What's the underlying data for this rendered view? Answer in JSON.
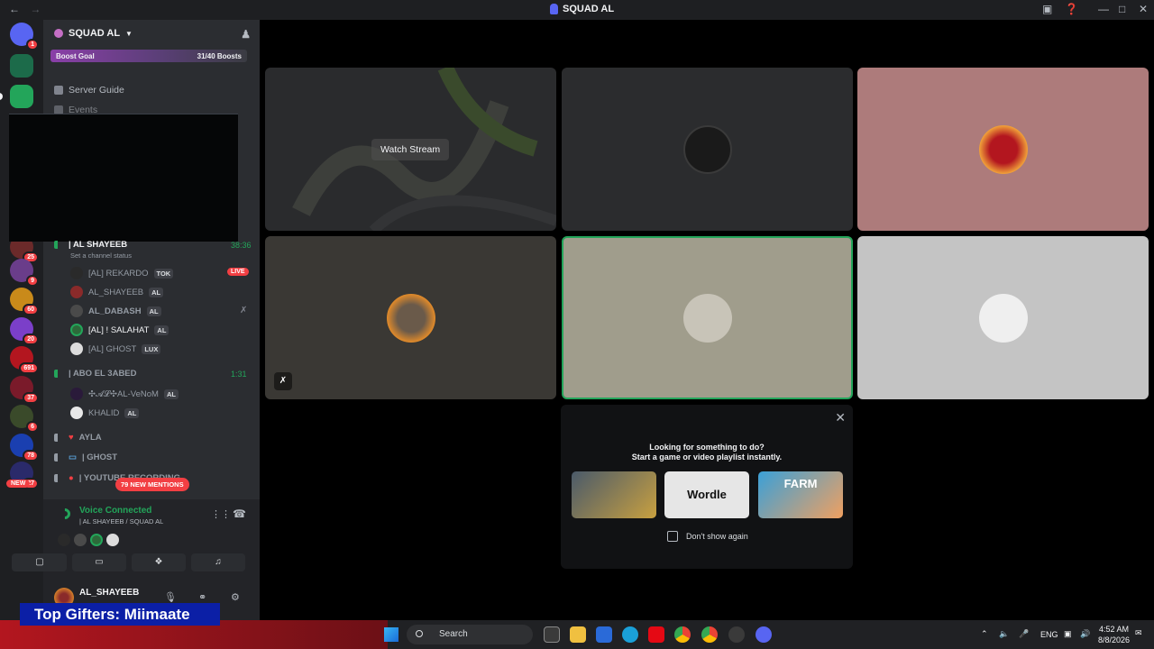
{
  "window": {
    "title": "SQUAD AL"
  },
  "guild_badges": [
    "1",
    "25",
    "9",
    "60",
    "20",
    "691",
    "37",
    "6",
    "78",
    "27"
  ],
  "new_badge": "NEW",
  "server": {
    "name": "SQUAD AL",
    "boost_label": "Boost Goal",
    "boost_progress": "31/40 Boosts",
    "boost_fraction": 0.775,
    "nav": [
      {
        "label": "Server Guide",
        "icon": "server-guide-icon"
      },
      {
        "label": "Events",
        "icon": "calendar-icon"
      }
    ]
  },
  "voice_channels": [
    {
      "name": "| AL SHAYEEB",
      "time": "38:36",
      "status": "Set a channel status",
      "members": [
        {
          "name": "[AL] REKARDO",
          "tag": "TOK",
          "live": "LIVE"
        },
        {
          "name": "AL_SHAYEEB",
          "tag": "AL"
        },
        {
          "name": "AL_DABASH",
          "tag": "AL"
        },
        {
          "name": "[AL] ! SALAHAT",
          "tag": "AL"
        },
        {
          "name": "[AL] GHOST",
          "tag": "LUX"
        }
      ]
    },
    {
      "name": "| ABO EL 3ABED",
      "time": "1:31",
      "members": [
        {
          "name": "✣𝓐𝓛✣AL-VeNoM",
          "tag": "AL"
        },
        {
          "name": "KHALID",
          "tag": "AL"
        }
      ]
    },
    {
      "name": "AYLA"
    },
    {
      "name": "| GHOST"
    },
    {
      "name": "| YOUTUBE RECORDING"
    }
  ],
  "mentions": "79 NEW MENTIONS",
  "voice_status": {
    "title": "Voice Connected",
    "subtitle": "| AL SHAYEEB / SQUAD AL"
  },
  "user": {
    "name": "AL_SHAYEEB"
  },
  "stage": {
    "watch_label": "Watch Stream",
    "activity": {
      "heading": "Looking for something to do?",
      "subheading": "Start a game or video playlist instantly.",
      "games": [
        "Wordle",
        "FARM"
      ],
      "checkbox_label": "Don't show again"
    }
  },
  "overlay": {
    "gifters": "Top Gifters: Miimaate"
  },
  "taskbar": {
    "search": "Search",
    "lang": "ENG",
    "time": "4:52 AM",
    "date": "8/8/2026"
  },
  "colors": {
    "accent_green": "#23a55a",
    "danger": "#f23f43",
    "tile_pink": "#ad7b7b",
    "tile_gray": "#c4c4c4",
    "tile_khaki": "#a09d8c"
  }
}
